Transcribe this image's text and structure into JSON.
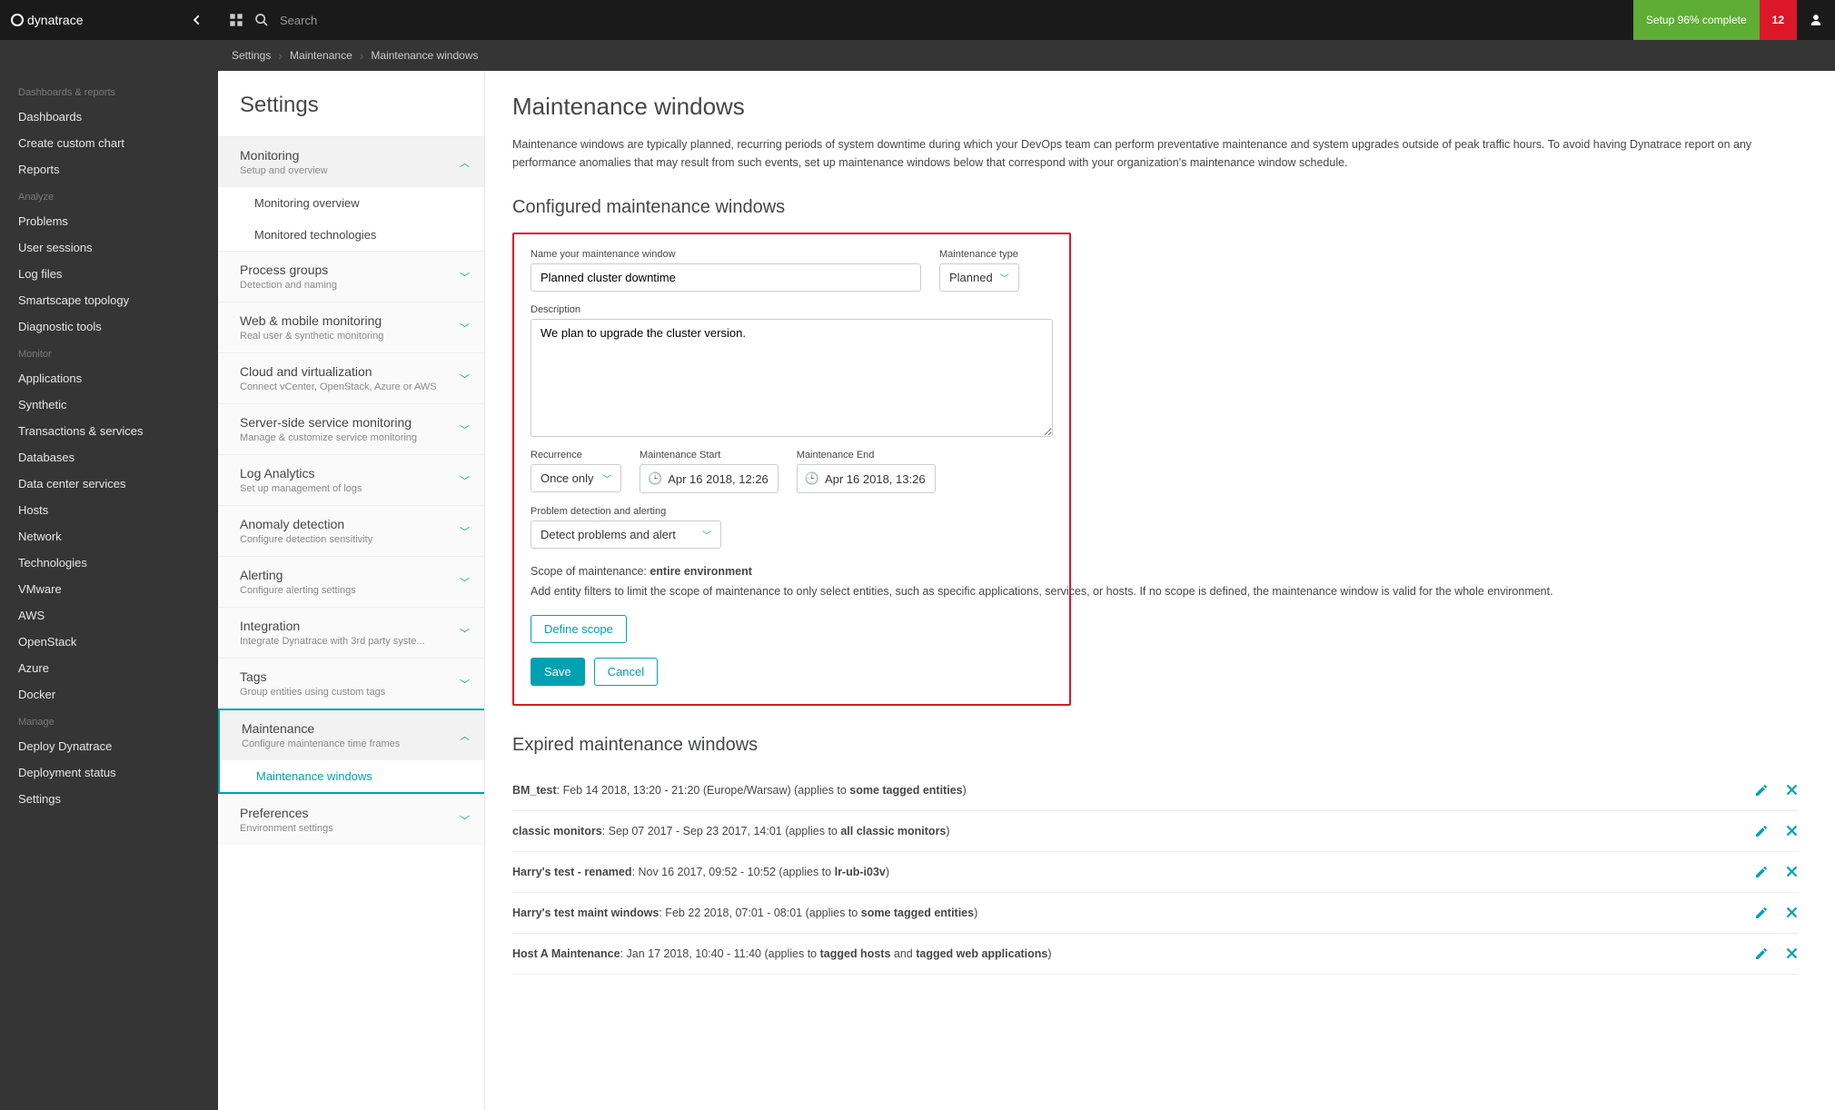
{
  "brand": "dynatrace",
  "topbar": {
    "search_placeholder": "Search",
    "setup_text": "Setup 96% complete",
    "notif_count": "12"
  },
  "breadcrumb": [
    "Settings",
    "Maintenance",
    "Maintenance windows"
  ],
  "leftnav": {
    "sections": [
      {
        "label": "Dashboards & reports",
        "items": [
          "Dashboards",
          "Create custom chart",
          "Reports"
        ]
      },
      {
        "label": "Analyze",
        "items": [
          "Problems",
          "User sessions",
          "Log files",
          "Smartscape topology",
          "Diagnostic tools"
        ]
      },
      {
        "label": "Monitor",
        "items": [
          "Applications",
          "Synthetic",
          "Transactions & services",
          "Databases",
          "Data center services",
          "Hosts",
          "Network",
          "Technologies",
          "VMware",
          "AWS",
          "OpenStack",
          "Azure",
          "Docker"
        ]
      },
      {
        "label": "Manage",
        "items": [
          "Deploy Dynatrace",
          "Deployment status",
          "Settings"
        ]
      }
    ]
  },
  "settings_panel": {
    "title": "Settings",
    "items": [
      {
        "title": "Monitoring",
        "sub": "Setup and overview",
        "expanded": true,
        "children": [
          "Monitoring overview",
          "Monitored technologies"
        ]
      },
      {
        "title": "Process groups",
        "sub": "Detection and naming"
      },
      {
        "title": "Web & mobile monitoring",
        "sub": "Real user & synthetic monitoring"
      },
      {
        "title": "Cloud and virtualization",
        "sub": "Connect vCenter, OpenStack, Azure or AWS"
      },
      {
        "title": "Server-side service monitoring",
        "sub": "Manage & customize service monitoring"
      },
      {
        "title": "Log Analytics",
        "sub": "Set up management of logs"
      },
      {
        "title": "Anomaly detection",
        "sub": "Configure detection sensitivity"
      },
      {
        "title": "Alerting",
        "sub": "Configure alerting settings"
      },
      {
        "title": "Integration",
        "sub": "Integrate Dynatrace with 3rd party syste..."
      },
      {
        "title": "Tags",
        "sub": "Group entities using custom tags"
      },
      {
        "title": "Maintenance",
        "sub": "Configure maintenance time frames",
        "expanded": true,
        "active": true,
        "children": [
          "Maintenance windows"
        ]
      },
      {
        "title": "Preferences",
        "sub": "Environment settings"
      }
    ]
  },
  "main": {
    "heading": "Maintenance windows",
    "intro": "Maintenance windows are typically planned, recurring periods of system downtime during which your DevOps team can perform preventative maintenance and system upgrades outside of peak traffic hours. To avoid having Dynatrace report on any performance anomalies that may result from such events, set up maintenance windows below that correspond with your organization's maintenance window schedule.",
    "configured_heading": "Configured maintenance windows",
    "form": {
      "name_label": "Name your maintenance window",
      "name_value": "Planned cluster downtime",
      "type_label": "Maintenance type",
      "type_value": "Planned",
      "desc_label": "Description",
      "desc_value": "We plan to upgrade the cluster version.",
      "recurrence_label": "Recurrence",
      "recurrence_value": "Once only",
      "start_label": "Maintenance Start",
      "start_value": "Apr 16 2018, 12:26",
      "end_label": "Maintenance End",
      "end_value": "Apr 16 2018, 13:26",
      "detection_label": "Problem detection and alerting",
      "detection_value": "Detect problems and alert",
      "scope_prefix": "Scope of maintenance: ",
      "scope_value": "entire environment",
      "scope_help": "Add entity filters to limit the scope of maintenance to only select entities, such as specific applications, services, or hosts. If no scope is defined, the maintenance window is valid for the whole environment.",
      "define_scope": "Define scope",
      "save": "Save",
      "cancel": "Cancel"
    },
    "expired_heading": "Expired maintenance windows",
    "expired": [
      {
        "name": "BM_test",
        "detail": ": Feb 14 2018, 13:20 - 21:20 (Europe/Warsaw) (applies to ",
        "suffix_bold": "some tagged entities",
        "close": ")"
      },
      {
        "name": "classic monitors",
        "detail": ": Sep 07 2017 - Sep 23 2017, 14:01 (applies to ",
        "suffix_bold": "all classic monitors",
        "close": ")"
      },
      {
        "name": "Harry's test - renamed",
        "detail": ": Nov 16 2017, 09:52 - 10:52 (applies to ",
        "suffix_bold": "lr-ub-i03v",
        "close": ")"
      },
      {
        "name": "Harry's test maint windows",
        "detail": ": Feb 22 2018, 07:01 - 08:01 (applies to ",
        "suffix_bold": "some tagged entities",
        "close": ")"
      },
      {
        "name": "Host A Maintenance",
        "detail": ": Jan 17 2018, 10:40 - 11:40 (applies to ",
        "suffix_bold": "tagged hosts",
        "mid": " and ",
        "suffix_bold2": "tagged web applications",
        "close": ")"
      }
    ]
  }
}
